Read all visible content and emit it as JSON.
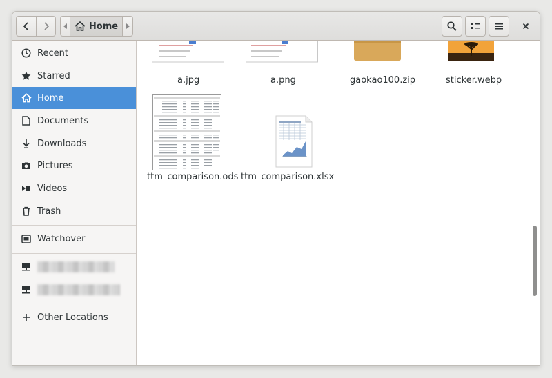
{
  "header": {
    "path_label": "Home",
    "back_icon": "chevron-left-icon",
    "forward_icon": "chevron-right-icon",
    "home_icon": "home-icon"
  },
  "sidebar": {
    "items": [
      {
        "label": "Recent",
        "icon": "clock-icon"
      },
      {
        "label": "Starred",
        "icon": "star-icon"
      },
      {
        "label": "Home",
        "icon": "home-icon"
      },
      {
        "label": "Documents",
        "icon": "document-icon"
      },
      {
        "label": "Downloads",
        "icon": "download-icon"
      },
      {
        "label": "Pictures",
        "icon": "camera-icon"
      },
      {
        "label": "Videos",
        "icon": "video-icon"
      },
      {
        "label": "Trash",
        "icon": "trash-icon"
      },
      {
        "label": "Watchover",
        "icon": "drive-icon"
      },
      {
        "label": "Other Locations",
        "icon": "plus-icon"
      }
    ],
    "network_items": [
      {
        "icon": "network-drive-icon"
      },
      {
        "icon": "network-drive-icon"
      }
    ]
  },
  "files": [
    {
      "name": "a.jpg"
    },
    {
      "name": "a.png"
    },
    {
      "name": "gaokao100.zip"
    },
    {
      "name": "sticker.webp"
    },
    {
      "name": "ttm_comparison.ods"
    },
    {
      "name": "ttm_comparison.xlsx"
    }
  ]
}
